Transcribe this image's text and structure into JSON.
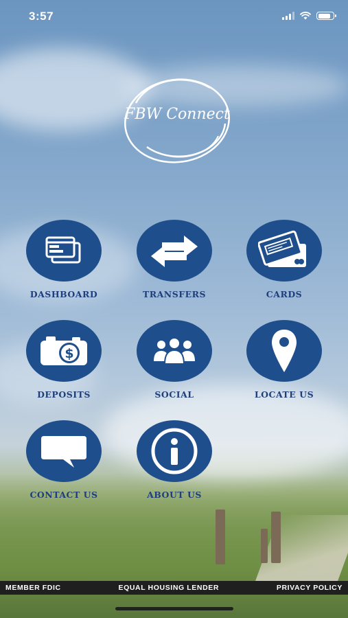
{
  "status_bar": {
    "time": "3:57"
  },
  "logo": {
    "text": "FBW Connect"
  },
  "menu": {
    "dashboard": "DASHBOARD",
    "transfers": "TRANSFERS",
    "cards": "CARDS",
    "deposits": "DEPOSITS",
    "social": "SOCIAL",
    "locate_us": "LOCATE US",
    "contact_us": "CONTACT US",
    "about_us": "ABOUT US"
  },
  "footer": {
    "member_fdic": "MEMBER FDIC",
    "equal_housing": "EQUAL HOUSING LENDER",
    "privacy_policy": "PRIVACY POLICY"
  },
  "colors": {
    "tile": "#1f4e8c",
    "label": "#1f3f7a",
    "footer": "#1f1f1f"
  }
}
